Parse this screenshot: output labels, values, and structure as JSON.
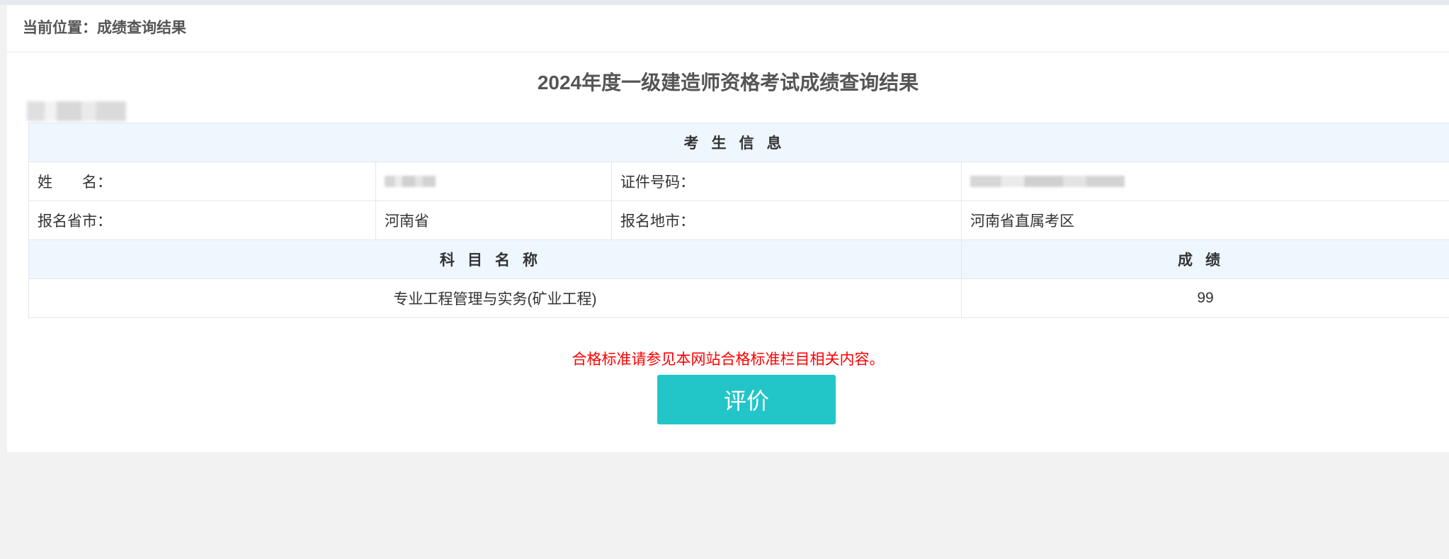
{
  "breadcrumb": "当前位置：成绩查询结果",
  "title": "2024年度一级建造师资格考试成绩查询结果",
  "info_header": "考生信息",
  "fields": {
    "name_label": "姓　　名：",
    "id_label": "证件号码：",
    "province_label": "报名省市：",
    "province_value": "河南省",
    "city_label": "报名地市：",
    "city_value": "河南省直属考区"
  },
  "scores_header": {
    "subject": "科目名称",
    "score": "成绩"
  },
  "scores": [
    {
      "subject": "专业工程管理与实务(矿业工程)",
      "score": "99"
    }
  ],
  "notice": "合格标准请参见本网站合格标准栏目相关内容。",
  "evaluate_button": "评价",
  "colors": {
    "accent": "#22c6c9",
    "notice": "#ff0000",
    "header_bg": "#eef6fe"
  }
}
